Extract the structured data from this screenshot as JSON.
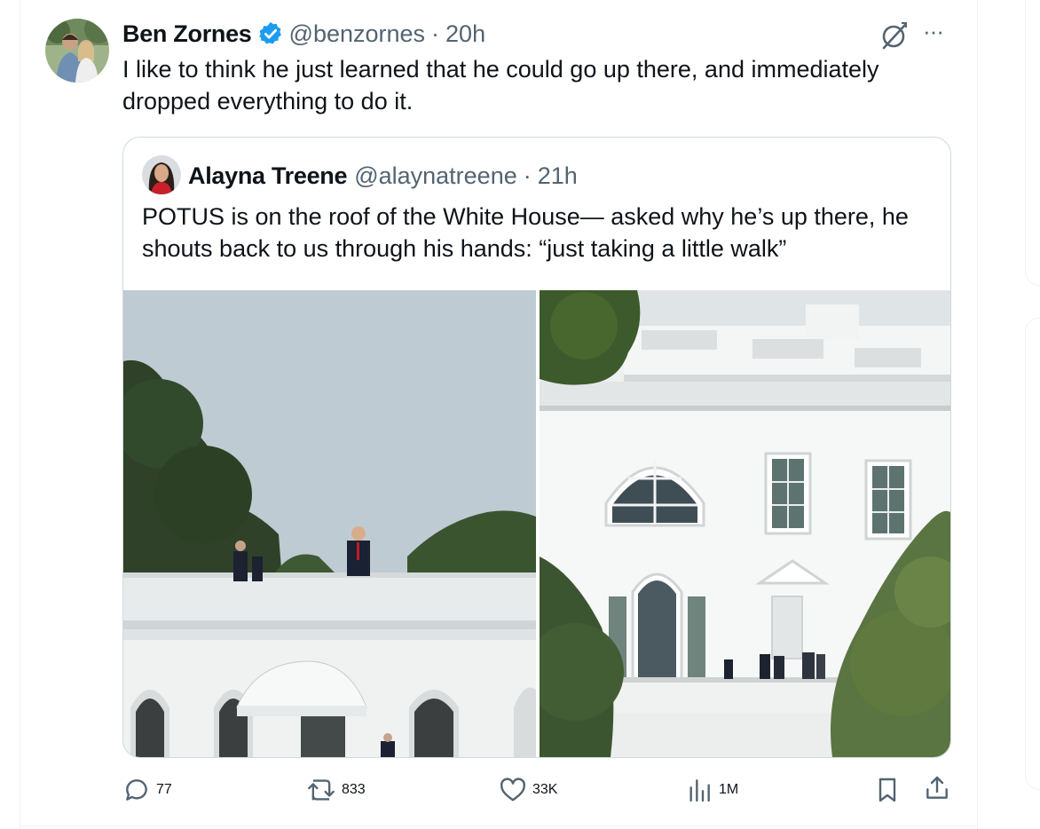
{
  "post": {
    "author_name": "Ben Zornes",
    "handle": "@benzornes",
    "time": "20h",
    "separator": "·",
    "more_label": "···",
    "text": "I like to think he just learned that he could go up there, and immediately dropped everything to do it."
  },
  "quoted": {
    "author_name": "Alayna Treene",
    "handle": "@alaynatreene",
    "separator": "·",
    "time": "21h",
    "text": "POTUS is on the roof of the White House— asked why he’s up there, he shouts back to us through his hands: “just taking a little walk”",
    "images": [
      "roof-photo",
      "white-house-photo"
    ]
  },
  "actions": {
    "replies": "77",
    "reposts": "833",
    "likes": "33K",
    "views": "1M"
  },
  "icons": {
    "verified": "verified-badge-icon",
    "grok": "grok-icon",
    "reply": "reply-icon",
    "repost": "repost-icon",
    "like": "heart-icon",
    "views": "views-icon",
    "bookmark": "bookmark-icon",
    "share": "share-icon"
  },
  "colors": {
    "verified": "#1d9bf0",
    "text": "#0f1419",
    "muted": "#536471",
    "border": "#cfd9de"
  }
}
